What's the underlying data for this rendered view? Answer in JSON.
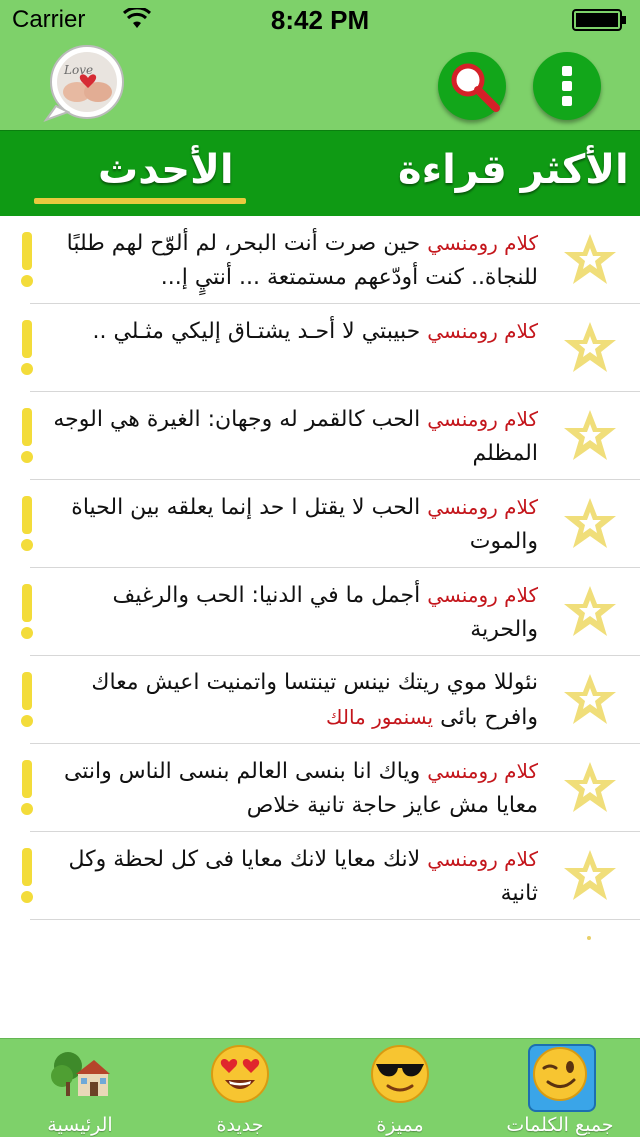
{
  "status": {
    "carrier": "Carrier",
    "time": "8:42 PM"
  },
  "header": {
    "logo_text": "Love",
    "search_icon": "search-icon",
    "menu_icon": "more-vertical-icon",
    "accent": "#12a61a"
  },
  "tabs": {
    "latest": "الأحدث",
    "most_read": "الأكثر قراءة",
    "selected": "الأحدث"
  },
  "items": [
    {
      "tag": "كلام رومنسي",
      "text": "حين صرت أنت البحر، لم ألوّح لهم طلبًا للنجاة.. كنت أودّعهم مستمتعة ... أنتيٍ إ..."
    },
    {
      "tag": "كلام رومنسي",
      "text": "حبيبتي لا أحـد يشتـاق إليكي مثـلي .."
    },
    {
      "tag": "كلام رومنسي",
      "text": "الحب كالقمر له وجهان: الغيرة هي الوجه المظلم"
    },
    {
      "tag": "كلام رومنسي",
      "text": "الحب لا يقتل ا حد إنما يعلقه بين الحياة والموت"
    },
    {
      "tag": "كلام رومنسي",
      "text": "أجمل ما في الدنيا: الحب والرغيف والحرية"
    },
    {
      "tag": "يسنمور مالك",
      "text": "نئوللا موي ريتك نينس تينتسا واتمنيت اعيش معاك وافرح بائى"
    },
    {
      "tag": "كلام رومنسي",
      "text": "وياك انا بنسى العالم بنسى الناس وانتى معايا مش عايز حاجة تانية خلاص"
    },
    {
      "tag": "كلام رومنسي",
      "text": "لانك معايا لانك معايا فى كل لحظة وكل ثانية"
    }
  ],
  "bottom_nav": [
    {
      "label": "الرئيسية",
      "icon": "home-icon"
    },
    {
      "label": "جديدة",
      "icon": "heart-eyes-emoji-icon"
    },
    {
      "label": "مميزة",
      "icon": "sunglasses-emoji-icon"
    },
    {
      "label": "جميع الكلمات",
      "icon": "wink-emoji-icon",
      "selected": true
    }
  ],
  "colors": {
    "bar_green": "#7ed16a",
    "tab_green": "#0f9a14",
    "tag_red": "#c4161c",
    "warning_yellow": "#f3dc3a",
    "star_yellow": "#f0de7a"
  }
}
